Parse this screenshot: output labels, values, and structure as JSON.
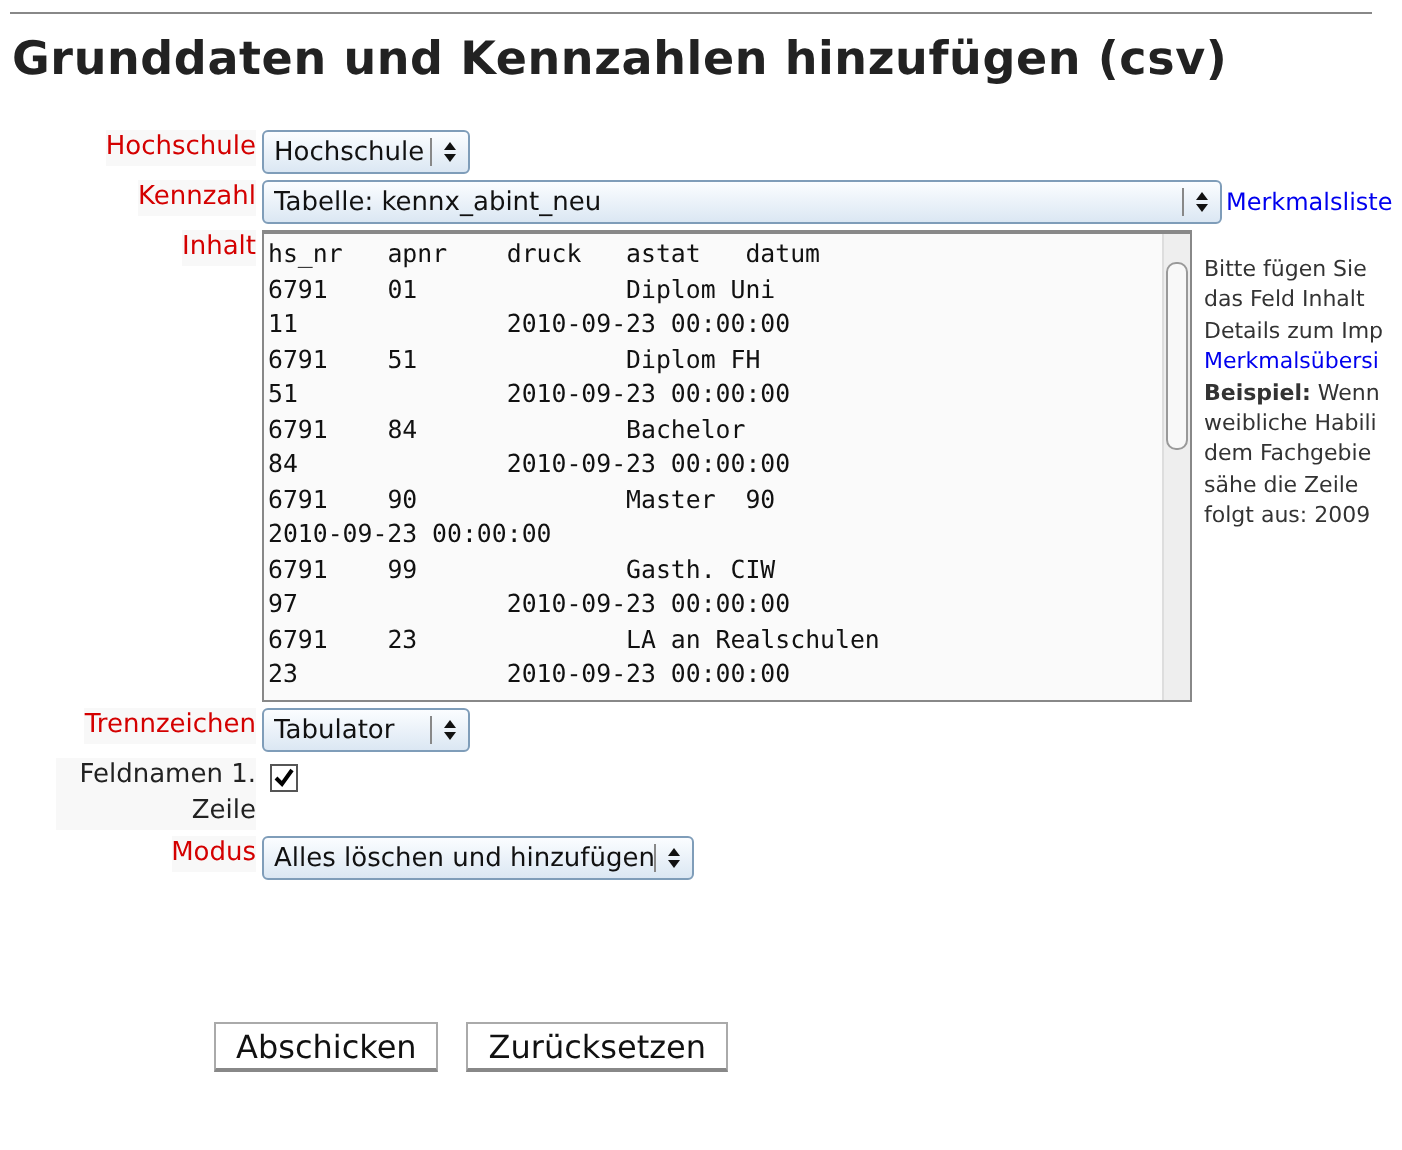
{
  "title": "Grunddaten und Kennzahlen hinzufügen (csv)",
  "fields": [
    {
      "kind": "select",
      "label": "Hochschule",
      "required": true,
      "value": "Hochschule"
    },
    {
      "kind": "select",
      "label": "Kennzahl",
      "required": true,
      "value": "Tabelle: kennx_abint_neu",
      "link": "Merkmalsliste"
    },
    {
      "kind": "textarea",
      "label": "Inhalt",
      "required": true,
      "lines": [
        "hs_nr\tapnr\tdruck\tastat\tdatum",
        "6791\t01\t\tDiplom Uni",
        "11\t\t2010-09-23 00:00:00",
        "6791\t51\t\tDiplom FH",
        "51\t\t2010-09-23 00:00:00",
        "6791\t84\t\tBachelor",
        "84\t\t2010-09-23 00:00:00",
        "6791\t90\t\tMaster  90",
        "2010-09-23 00:00:00",
        "6791\t99\t\tGasth. CIW",
        "97\t\t2010-09-23 00:00:00",
        "6791\t23\t\tLA an Realschulen",
        "23\t\t2010-09-23 00:00:00"
      ],
      "help": [
        {
          "kind": "text",
          "text": "Bitte fügen Sie"
        },
        {
          "kind": "text",
          "text": "das Feld Inhalt"
        },
        {
          "kind": "text",
          "text": "Details zum Imp"
        },
        {
          "kind": "link",
          "text": "Merkmalsübersi"
        },
        {
          "kind": "text",
          "text": "**Beispiel:** Wenn"
        },
        {
          "kind": "text",
          "text": "weibliche Habili"
        },
        {
          "kind": "text",
          "text": "dem Fachgebie"
        },
        {
          "kind": "text",
          "text": "sähe die Zeile"
        },
        {
          "kind": "text",
          "text": "folgt aus: 2009"
        }
      ]
    },
    {
      "kind": "select",
      "label": "Trennzeichen",
      "required": true,
      "value": "Tabulator"
    },
    {
      "kind": "checkbox",
      "label": "Feldnamen 1. Zeile",
      "required": false,
      "checked": true
    },
    {
      "kind": "select",
      "label": "Modus",
      "required": true,
      "value": "Alles löschen und hinzufügen"
    }
  ],
  "buttons": [
    "Abschicken",
    "Zurücksetzen"
  ]
}
